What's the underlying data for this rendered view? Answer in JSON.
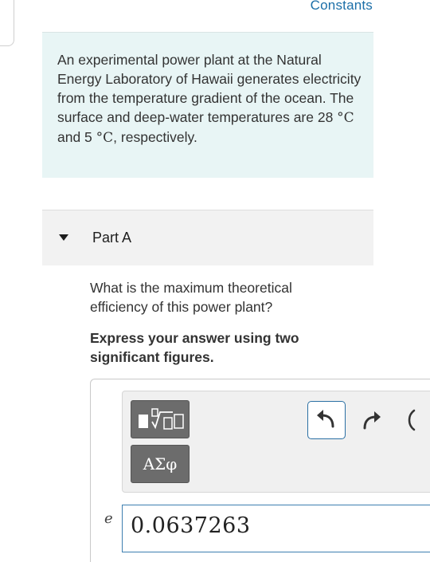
{
  "header": {
    "constants_link": "Constants"
  },
  "problem": {
    "intro_part1": "An experimental power plant at the Natural Energy Laboratory of Hawaii generates electricity from the temperature gradient of the ocean. The surface and deep-water temperatures are 28 ",
    "temp_surface_unit": "°C",
    "intro_part2": " and 5 ",
    "temp_deep_unit": "°C",
    "intro_part3": ", respectively."
  },
  "part": {
    "label": "Part A",
    "question": "What is the maximum theoretical efficiency of this power plant?",
    "instruction": "Express your answer using two significant figures."
  },
  "toolbar": {
    "templates_icon": "templates-sqrt-icon",
    "greek_label": "ΑΣφ",
    "undo_icon": "undo-arrow-icon",
    "redo_icon": "redo-arrow-icon",
    "reset_icon": "reset-icon"
  },
  "answer": {
    "variable": "e",
    "value": "0.0637263"
  }
}
